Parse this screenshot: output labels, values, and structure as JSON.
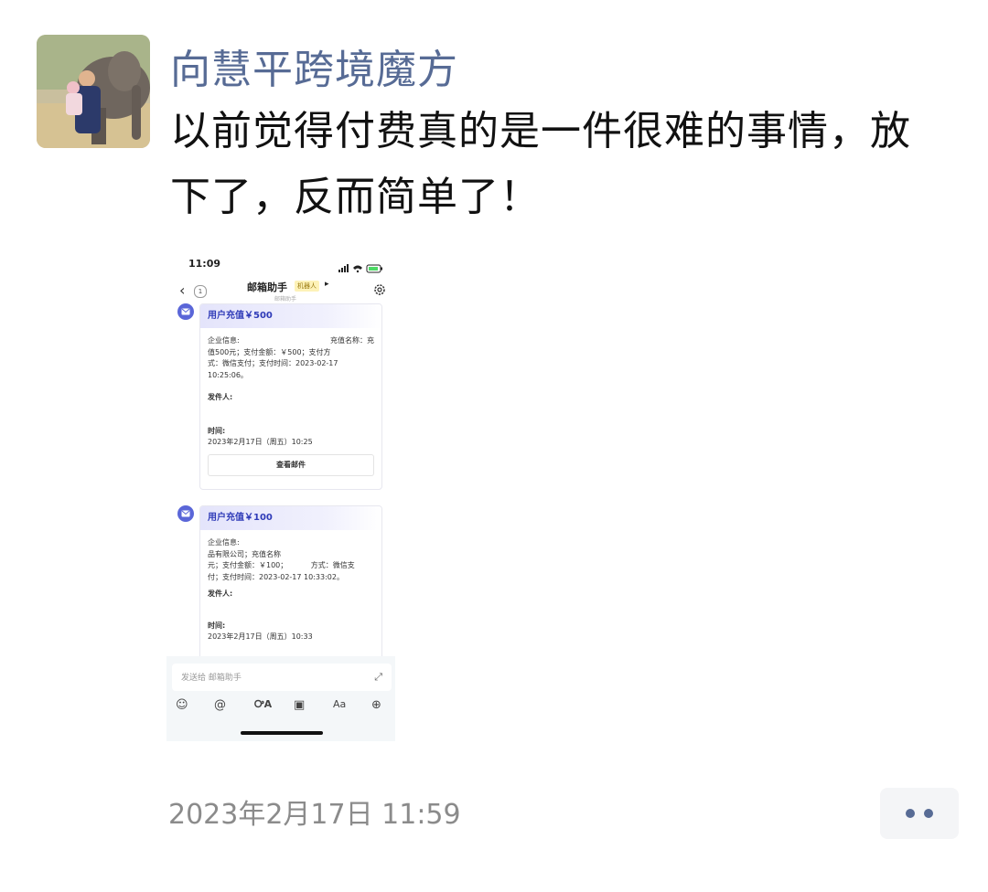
{
  "post": {
    "author": "向慧平跨境魔方",
    "text": "以前觉得付费真的是一件很难的事情，放下了，反而简单了！",
    "timestamp": "2023年2月17日 11:59"
  },
  "screenshot": {
    "status_time": "11:09",
    "nav": {
      "back_count": "1",
      "title": "邮箱助手",
      "robot_tag": "机器人",
      "subtitle": "邮箱助手"
    },
    "cards": [
      {
        "header": "用户充值￥500",
        "info_label": "企业信息:",
        "info_right": "充值名称：充",
        "line2": "值500元；支付金额：￥500；支付方",
        "line3": "式：微信支付；支付时间：2023-02-17",
        "line4": "10:25:06。",
        "sender_label": "发件人:",
        "time_label": "时间:",
        "time_value": "2023年2月17日（周五）10:25",
        "button": "查看邮件"
      },
      {
        "header": "用户充值￥100",
        "info_label": "企业信息:",
        "line2": "品有限公司；充值名称",
        "line3": "元；支付金额：￥100；          方式：微信支",
        "line4": "付；支付时间：2023-02-17 10:33:02。",
        "sender_label": "发件人:",
        "time_label": "时间:",
        "time_value": "2023年2月17日（周五）10:33"
      }
    ],
    "input_placeholder": "发送给 邮箱助手"
  },
  "colors": {
    "author": "#576b95",
    "card_header_text": "#2f3bb8",
    "mail_icon": "#5a66d8"
  }
}
